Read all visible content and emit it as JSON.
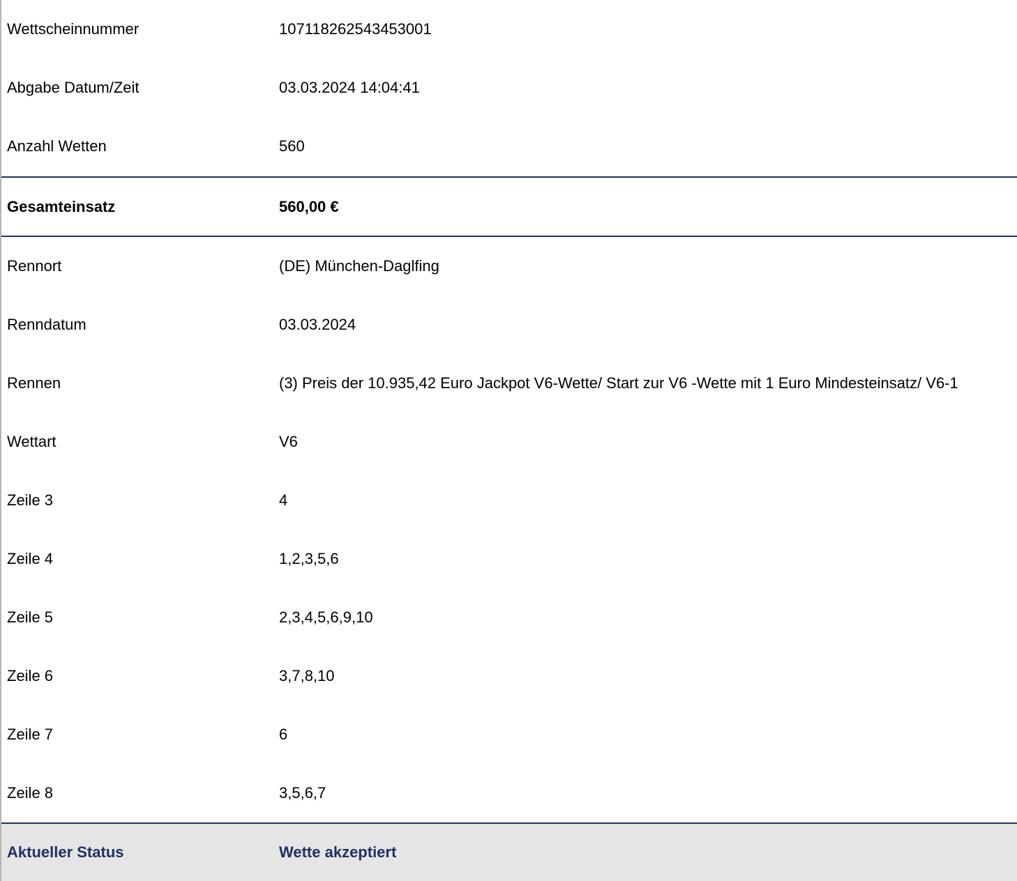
{
  "top_rows": [
    {
      "label": "Wettscheinnummer",
      "value": "107118262543453001"
    },
    {
      "label": "Abgabe Datum/Zeit",
      "value": "03.03.2024 14:04:41"
    },
    {
      "label": "Anzahl Wetten",
      "value": "560"
    }
  ],
  "total": {
    "label": "Gesamteinsatz",
    "value": "560,00 €"
  },
  "race_rows": [
    {
      "label": "Rennort",
      "value": "(DE) München-Daglfing"
    },
    {
      "label": "Renndatum",
      "value": "03.03.2024"
    },
    {
      "label": "Rennen",
      "value": "(3) Preis der 10.935,42 Euro Jackpot V6-Wette/ Start zur V6 -Wette mit 1 Euro Mindesteinsatz/ V6-1"
    },
    {
      "label": "Wettart",
      "value": "V6"
    },
    {
      "label": "Zeile 3",
      "value": "4"
    },
    {
      "label": "Zeile 4",
      "value": "1,2,3,5,6"
    },
    {
      "label": "Zeile 5",
      "value": "2,3,4,5,6,9,10"
    },
    {
      "label": "Zeile 6",
      "value": "3,7,8,10"
    },
    {
      "label": "Zeile 7",
      "value": "6"
    },
    {
      "label": "Zeile 8",
      "value": "3,5,6,7"
    }
  ],
  "status": {
    "label": "Aktueller Status",
    "value": "Wette akzeptiert"
  },
  "colors": {
    "accent": "#1f3163",
    "status_background": "#e5e5e5",
    "left_border": "#b5b5b5"
  }
}
